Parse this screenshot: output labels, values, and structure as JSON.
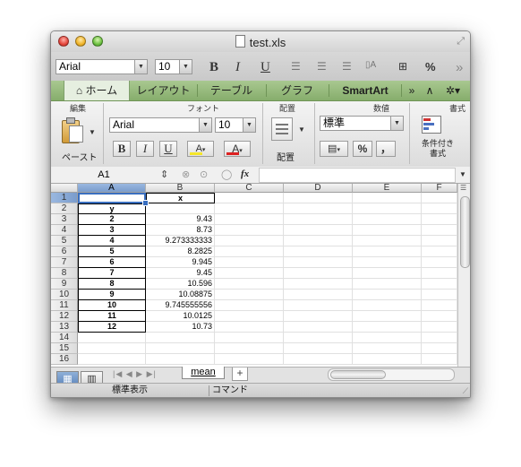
{
  "window": {
    "title": "test.xls"
  },
  "toolbar": {
    "font_name": "Arial",
    "font_size": "10",
    "bold": "B",
    "italic": "I",
    "underline": "U",
    "percent": "%",
    "more": "»"
  },
  "tabs": [
    {
      "label": "ホーム",
      "active": true
    },
    {
      "label": "レイアウト"
    },
    {
      "label": "テーブル"
    },
    {
      "label": "グラフ"
    },
    {
      "label": "SmartArt"
    }
  ],
  "ribbon": {
    "groups": {
      "edit": "編集",
      "font": "フォント",
      "alignment": "配置",
      "number": "数値",
      "format": "書式"
    },
    "paste_label": "ペースト",
    "font_name": "Arial",
    "font_size": "10",
    "bold": "B",
    "italic": "I",
    "underline": "U",
    "fill_glyph": "A",
    "font_color_glyph": "A",
    "align_label": "配置",
    "number_format": "標準",
    "percent": "%",
    "comma": "，",
    "conditional_label": "条件付き書式"
  },
  "formula_bar": {
    "cell_ref": "A1",
    "fx": "fx"
  },
  "sheet": {
    "columns": [
      "A",
      "B",
      "C",
      "D",
      "E",
      "F"
    ],
    "rows": [
      "1",
      "2",
      "3",
      "4",
      "5",
      "6",
      "7",
      "8",
      "9",
      "10",
      "11",
      "12",
      "13",
      "14",
      "15",
      "16"
    ],
    "cells": {
      "A": [
        "",
        "y",
        "2",
        "3",
        "4",
        "5",
        "6",
        "7",
        "8",
        "9",
        "10",
        "11",
        "12",
        "",
        "",
        ""
      ],
      "B": [
        "x",
        "",
        "9.43",
        "8.73",
        "9.273333333",
        "8.2825",
        "9.945",
        "9.45",
        "10.596",
        "10.08875",
        "9.745555556",
        "10.0125",
        "10.73",
        "",
        "",
        ""
      ]
    }
  },
  "sheet_tab": "mean",
  "status": {
    "view": "標準表示",
    "mode": "コマンド"
  },
  "colors": {
    "tab_bar": "#9fbe87",
    "selection": "#3a6fc0"
  }
}
